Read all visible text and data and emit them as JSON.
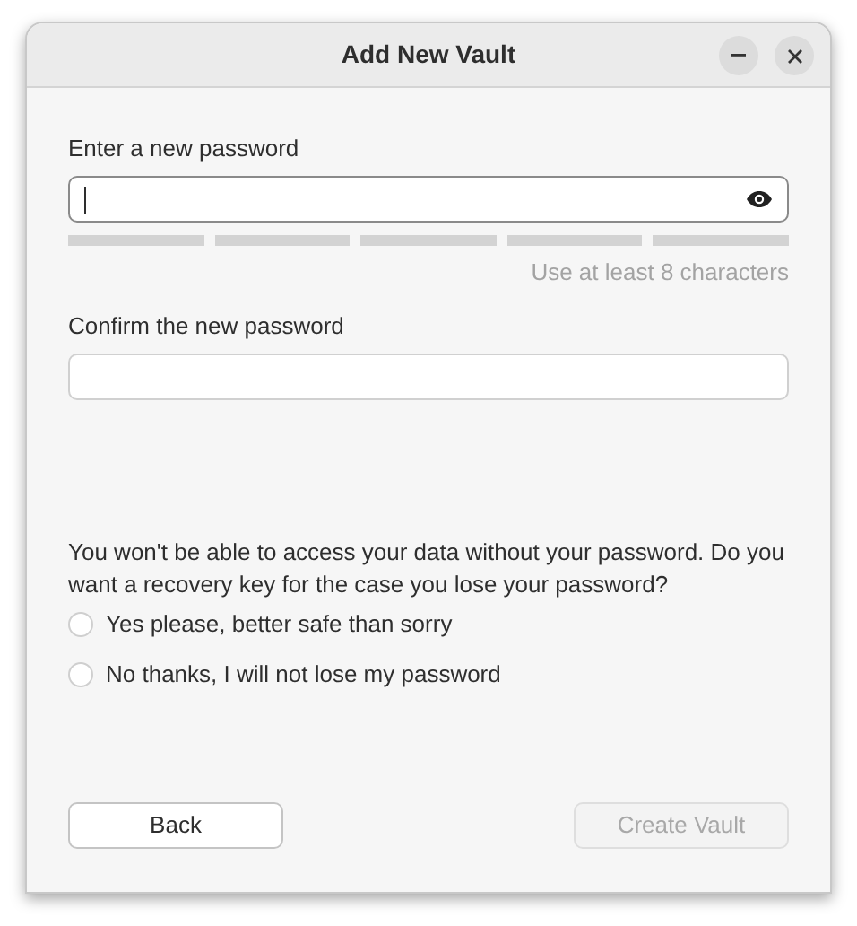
{
  "window": {
    "title": "Add New Vault"
  },
  "password": {
    "label": "Enter a new password",
    "focused": true
  },
  "hint": "Use at least 8 characters",
  "confirm": {
    "label": "Confirm the new password",
    "focused": false
  },
  "question": "You won't be able to access your data without your password. Do you want a recovery key for the case you lose your password?",
  "options": [
    {
      "label": "Yes please, better safe than sorry",
      "selected": false
    },
    {
      "label": "No thanks, I will not lose my password",
      "selected": false
    }
  ],
  "buttons": [
    {
      "label": "Back",
      "disabled": false
    },
    {
      "label": "Create Vault",
      "disabled": true
    }
  ]
}
